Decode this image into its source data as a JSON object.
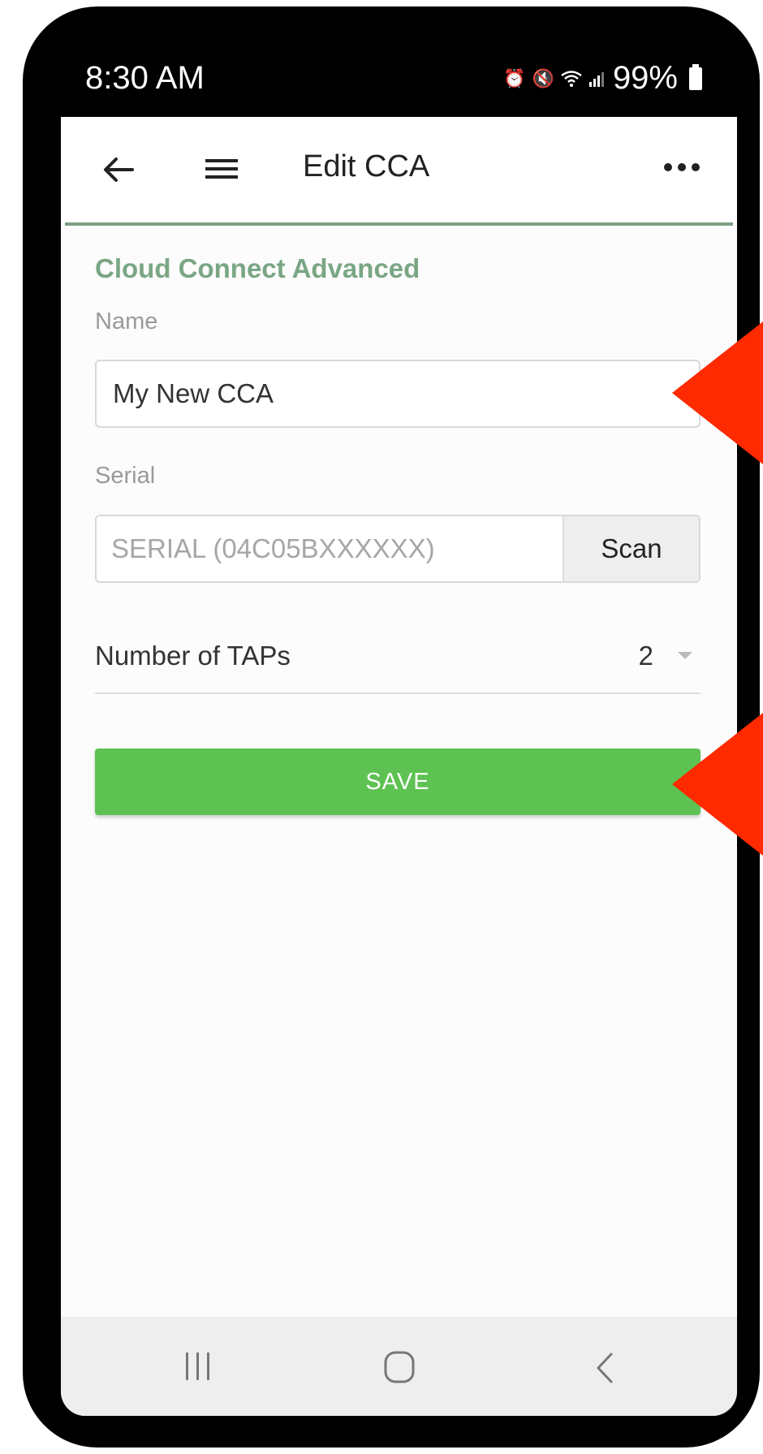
{
  "status_bar": {
    "time": "8:30 AM",
    "battery": "99%",
    "icons": [
      "alarm-icon",
      "mute-icon",
      "wifi-icon",
      "signal-icon",
      "battery-icon"
    ]
  },
  "app_bar": {
    "title": "Edit CCA",
    "icons": [
      "back-arrow-icon",
      "hamburger-menu-icon",
      "more-options-icon"
    ]
  },
  "form": {
    "section_title": "Cloud Connect Advanced",
    "name": {
      "label": "Name",
      "value": "My New CCA"
    },
    "serial": {
      "label": "Serial",
      "placeholder": "SERIAL (04C05BXXXXXX)",
      "value": "",
      "scan_label": "Scan"
    },
    "taps": {
      "label": "Number of TAPs",
      "value": "2"
    },
    "save_label": "SAVE"
  },
  "nav_bar": {
    "icons": [
      "recent-apps-icon",
      "home-icon",
      "system-back-icon"
    ]
  },
  "colors": {
    "accent": "#7aa684",
    "divider": "#7f9f86",
    "save_button": "#5dc252",
    "annotation": "#ff2a00"
  }
}
